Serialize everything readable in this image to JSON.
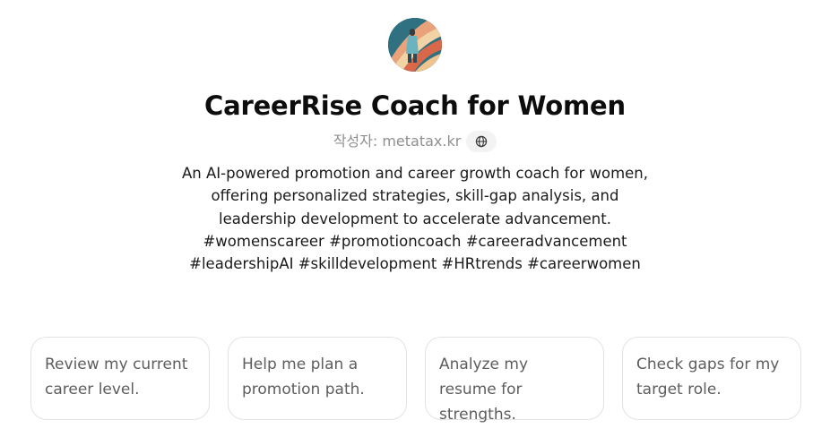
{
  "gpt": {
    "title": "CareerRise Coach for Women",
    "author": "작성자: metatax.kr",
    "website_icon": "globe-icon",
    "avatar_icon": "avatar-image",
    "description": "An AI-powered promotion and career growth coach for women, offering personalized strategies, skill-gap analysis, and leadership development to accelerate advancement. #womenscareer #promotioncoach #careeradvancement #leadershipAI #skilldevelopment #HRtrends #careerwomen"
  },
  "starters": [
    {
      "label": "Review my current career level."
    },
    {
      "label": "Help me plan a promotion path."
    },
    {
      "label": "Analyze my resume for strengths."
    },
    {
      "label": "Check gaps for my target role."
    }
  ],
  "colors": {
    "text_primary": "#0d0d0d",
    "text_muted": "#8f8f8f",
    "starter_text": "#5d5d5d",
    "starter_border": "#e3e3e3"
  }
}
